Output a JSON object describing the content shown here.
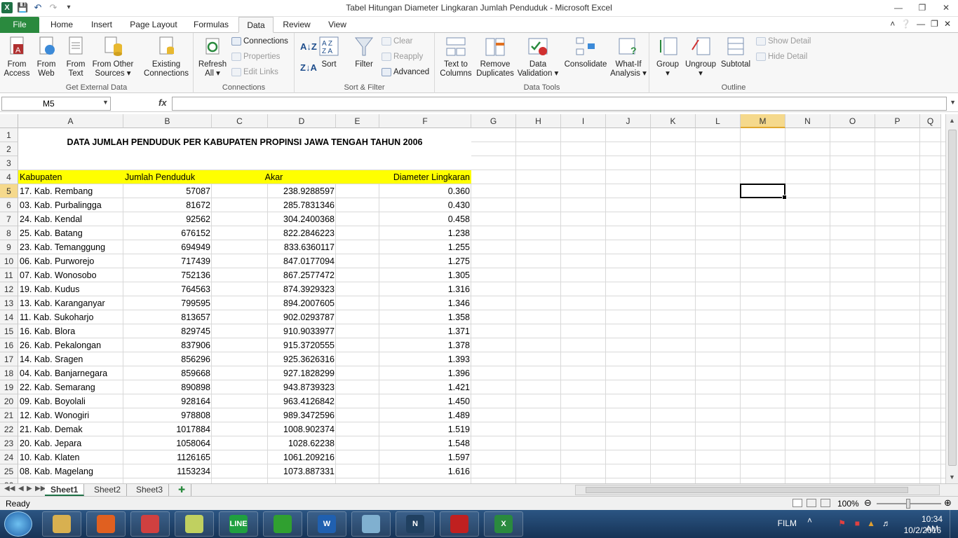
{
  "window": {
    "title": "Tabel Hitungan Diameter Lingkaran Jumlah Penduduk  -  Microsoft Excel",
    "controls": [
      "minimize-icon",
      "restore-icon",
      "close-icon"
    ]
  },
  "tabs": [
    "File",
    "Home",
    "Insert",
    "Page Layout",
    "Formulas",
    "Data",
    "Review",
    "View"
  ],
  "active_tab": "Data",
  "ribbon": {
    "get_external": {
      "label": "Get External Data",
      "buttons": [
        [
          "From",
          "Access"
        ],
        [
          "From",
          "Web"
        ],
        [
          "From",
          "Text"
        ],
        [
          "From Other",
          "Sources"
        ],
        [
          "Existing",
          "Connections"
        ]
      ]
    },
    "connections": {
      "label": "Connections",
      "refresh": [
        "Refresh",
        "All"
      ],
      "items": [
        "Connections",
        "Properties",
        "Edit Links"
      ]
    },
    "sort_filter": {
      "label": "Sort & Filter",
      "sort": "Sort",
      "filter": "Filter",
      "items": [
        "Clear",
        "Reapply",
        "Advanced"
      ]
    },
    "data_tools": {
      "label": "Data Tools",
      "buttons": [
        [
          "Text to",
          "Columns"
        ],
        [
          "Remove",
          "Duplicates"
        ],
        [
          "Data",
          "Validation"
        ],
        [
          "Consolidate",
          ""
        ],
        [
          "What-If",
          "Analysis"
        ]
      ]
    },
    "outline": {
      "label": "Outline",
      "buttons": [
        "Group",
        "Ungroup",
        "Subtotal"
      ],
      "items": [
        "Show Detail",
        "Hide Detail"
      ]
    }
  },
  "formula_bar": {
    "name_box": "M5",
    "fx": "fx",
    "formula": ""
  },
  "columns": [
    "A",
    "B",
    "C",
    "D",
    "E",
    "F",
    "G",
    "H",
    "I",
    "J",
    "K",
    "L",
    "M",
    "N",
    "O",
    "P",
    "Q"
  ],
  "selected_column": "M",
  "selected_row": "5",
  "sheet": {
    "title": "DATA JUMLAH PENDUDUK PER KABUPATEN PROPINSI JAWA TENGAH TAHUN 2006",
    "headers": {
      "a": "Kabupaten",
      "b": "Jumlah Penduduk",
      "d": "Akar",
      "f": "Diameter Lingkaran"
    },
    "rows": [
      {
        "r": "5",
        "a": "17. Kab. Rembang",
        "b": "57087",
        "d": "238.9288597",
        "f": "0.360"
      },
      {
        "r": "6",
        "a": "03. Kab. Purbalingga",
        "b": "81672",
        "d": "285.7831346",
        "f": "0.430"
      },
      {
        "r": "7",
        "a": "24. Kab. Kendal",
        "b": "92562",
        "d": "304.2400368",
        "f": "0.458"
      },
      {
        "r": "8",
        "a": "25. Kab. Batang",
        "b": "676152",
        "d": "822.2846223",
        "f": "1.238"
      },
      {
        "r": "9",
        "a": "23. Kab. Temanggung",
        "b": "694949",
        "d": "833.6360117",
        "f": "1.255"
      },
      {
        "r": "10",
        "a": "06. Kab. Purworejo",
        "b": "717439",
        "d": "847.0177094",
        "f": "1.275"
      },
      {
        "r": "11",
        "a": "07. Kab. Wonosobo",
        "b": "752136",
        "d": "867.2577472",
        "f": "1.305"
      },
      {
        "r": "12",
        "a": "19. Kab. Kudus",
        "b": "764563",
        "d": "874.3929323",
        "f": "1.316"
      },
      {
        "r": "13",
        "a": "13. Kab. Karanganyar",
        "b": "799595",
        "d": "894.2007605",
        "f": "1.346"
      },
      {
        "r": "14",
        "a": "11. Kab. Sukoharjo",
        "b": "813657",
        "d": "902.0293787",
        "f": "1.358"
      },
      {
        "r": "15",
        "a": "16. Kab. Blora",
        "b": "829745",
        "d": "910.9033977",
        "f": "1.371"
      },
      {
        "r": "16",
        "a": "26. Kab. Pekalongan",
        "b": "837906",
        "d": "915.3720555",
        "f": "1.378"
      },
      {
        "r": "17",
        "a": "14. Kab. Sragen",
        "b": "856296",
        "d": "925.3626316",
        "f": "1.393"
      },
      {
        "r": "18",
        "a": "04. Kab. Banjarnegara",
        "b": "859668",
        "d": "927.1828299",
        "f": "1.396"
      },
      {
        "r": "19",
        "a": "22. Kab. Semarang",
        "b": "890898",
        "d": "943.8739323",
        "f": "1.421"
      },
      {
        "r": "20",
        "a": "09. Kab. Boyolali",
        "b": "928164",
        "d": "963.4126842",
        "f": "1.450"
      },
      {
        "r": "21",
        "a": "12. Kab. Wonogiri",
        "b": "978808",
        "d": "989.3472596",
        "f": "1.489"
      },
      {
        "r": "22",
        "a": "21. Kab. Demak",
        "b": "1017884",
        "d": "1008.902374",
        "f": "1.519"
      },
      {
        "r": "23",
        "a": "20. Kab. Jepara",
        "b": "1058064",
        "d": "1028.62238",
        "f": "1.548"
      },
      {
        "r": "24",
        "a": "10. Kab. Klaten",
        "b": "1126165",
        "d": "1061.209216",
        "f": "1.597"
      },
      {
        "r": "25",
        "a": "08. Kab. Magelang",
        "b": "1153234",
        "d": "1073.887331",
        "f": "1.616"
      }
    ]
  },
  "sheet_tabs": [
    "Sheet1",
    "Sheet2",
    "Sheet3"
  ],
  "status": {
    "ready": "Ready",
    "zoom": "100%"
  },
  "taskbar": {
    "apps": [
      "explorer",
      "firefox",
      "chrome",
      "sticky-notes",
      "LINE",
      "autocad",
      "W",
      "notepad",
      "N",
      "pdf",
      "X"
    ],
    "film": "FILM",
    "time": "10:34 AM",
    "date": "10/2/2016"
  }
}
